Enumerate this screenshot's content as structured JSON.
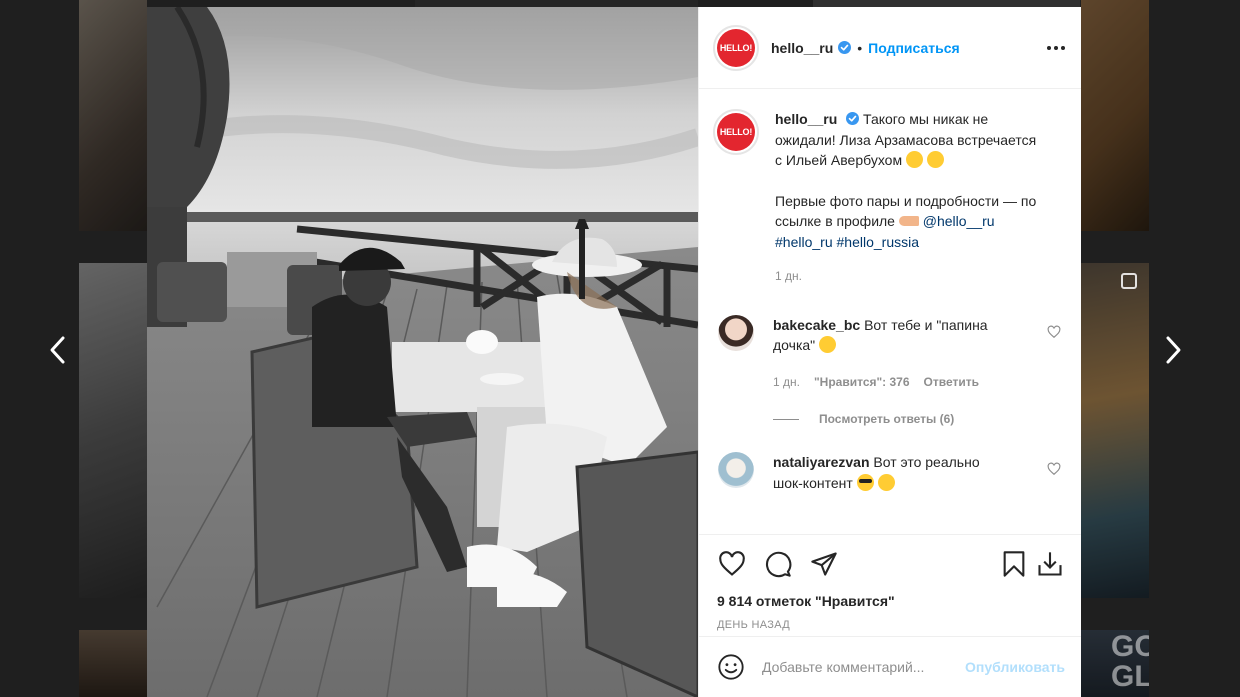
{
  "post": {
    "username": "hello__ru",
    "avatar_text": "HELLO!",
    "follow_label": "Подписаться",
    "separator": "•",
    "more_icon": "more-horizontal-icon",
    "verified_icon": "verified-badge-icon"
  },
  "caption": {
    "username": "hello__ru",
    "line1": "Такого мы никак не ожидали! Лиза Арзамасова встречается с Ильей Авербухом",
    "line2": "Первые фото пары и подробности — по ссылке в профиле",
    "mentions": [
      "@hello__ru",
      "#hello_ru",
      "#hello_russia"
    ],
    "time": "1 дн."
  },
  "comments": [
    {
      "username": "bakecake_bc",
      "text": "Вот тебе и \"папина дочка\"",
      "time": "1 дн.",
      "likes": "\"Нравится\": 376",
      "reply_label": "Ответить",
      "view_replies": "Посмотреть ответы (6)"
    },
    {
      "username": "nataliyarezvan",
      "text": "Вот это реально шок-контент"
    }
  ],
  "stats": {
    "likes": "9 814 отметок \"Нравится\"",
    "date": "ДЕНЬ НАЗАД"
  },
  "comment_box": {
    "placeholder": "Добавьте комментарий...",
    "publish_label": "Опубликовать"
  },
  "background": {
    "tile_text": "GO GL"
  },
  "colors": {
    "accent": "#0095f6",
    "brand_red": "#e3262f",
    "link": "#00376b"
  }
}
